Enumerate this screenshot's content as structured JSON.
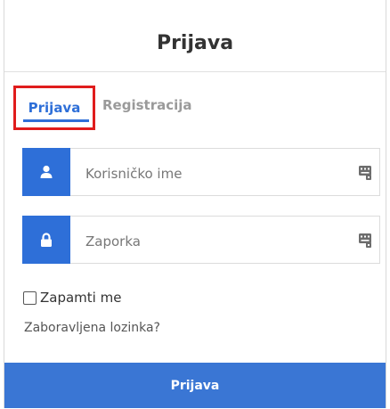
{
  "title": "Prijava",
  "tabs": [
    {
      "label": "Prijava",
      "active": true
    },
    {
      "label": "Registracija",
      "active": false
    }
  ],
  "form": {
    "username": {
      "placeholder": "Korisničko ime",
      "value": "",
      "icon": "user-icon"
    },
    "password": {
      "placeholder": "Zaporka",
      "value": "",
      "icon": "lock-icon"
    },
    "remember_label": "Zapamti me",
    "forgot_label": "Zaboravljena lozinka?",
    "submit_label": "Prijava"
  },
  "colors": {
    "accent": "#2e6fd8",
    "highlight": "#e01c1c",
    "muted": "#9a9a9a"
  }
}
